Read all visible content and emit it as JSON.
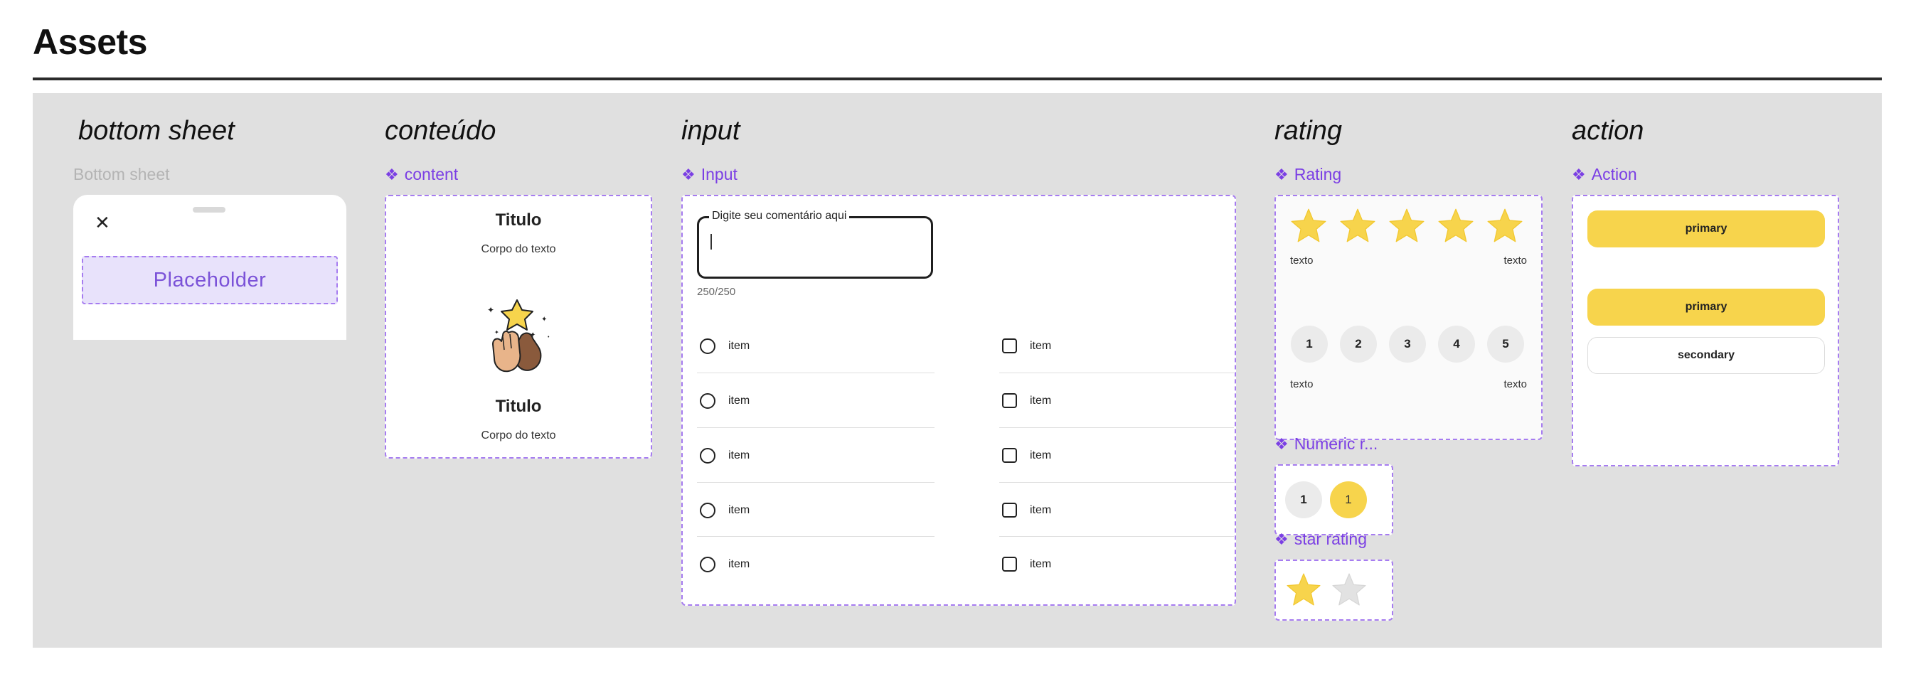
{
  "page": {
    "title": "Assets"
  },
  "sections": {
    "bottom_sheet": {
      "title": "bottom sheet",
      "component_label": "Bottom sheet",
      "close_glyph": "✕",
      "placeholder": "Placeholder"
    },
    "content": {
      "title": "conteúdo",
      "component_label": "content",
      "title_1": "Titulo",
      "body_1": "Corpo do texto",
      "illustration": "high-five-star-illustration",
      "title_2": "Titulo",
      "body_2": "Corpo do texto"
    },
    "input": {
      "title": "input",
      "component_label": "Input",
      "field_label": "Digite seu comentário aqui",
      "char_count": "250/250",
      "radio_items": [
        "item",
        "item",
        "item",
        "item",
        "item"
      ],
      "checkbox_items": [
        "item",
        "item",
        "item",
        "item",
        "item"
      ]
    },
    "rating": {
      "title": "rating",
      "component_label": "Rating",
      "stars_filled": 5,
      "stars_total": 5,
      "star_text_left": "texto",
      "star_text_right": "texto",
      "numbers": [
        "1",
        "2",
        "3",
        "4",
        "5"
      ],
      "num_text_left": "texto",
      "num_text_right": "texto",
      "numeric_label": "Numeric r...",
      "numeric_states": [
        {
          "value": "1",
          "state": "default"
        },
        {
          "value": "1",
          "state": "selected"
        }
      ],
      "star_rating_label": "star rating",
      "star_rating_states": [
        "filled",
        "empty"
      ]
    },
    "action": {
      "title": "action",
      "component_label": "Action",
      "variant_1": {
        "primary": "primary"
      },
      "variant_2": {
        "primary": "primary",
        "secondary": "secondary"
      }
    }
  },
  "colors": {
    "accent_purple": "#7b3fe4",
    "dashed_border": "#a67cf0",
    "placeholder_fill": "#e8e2fb",
    "primary_yellow": "#f7d44c",
    "star_yellow": "#f7d44c",
    "star_empty": "#e2e2e2",
    "canvas_grey": "#e0e0e0"
  },
  "icons": {
    "component": "component-diamond-icon",
    "close": "close-icon",
    "star": "star-icon",
    "radio": "radio-button-icon",
    "checkbox": "checkbox-icon"
  }
}
